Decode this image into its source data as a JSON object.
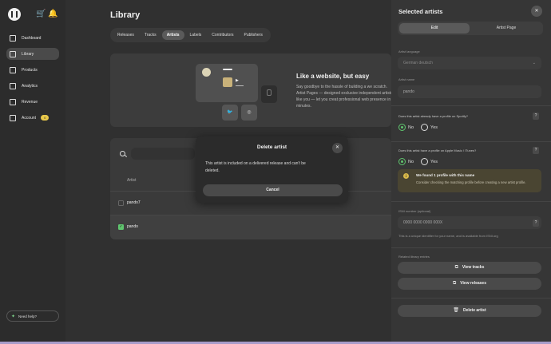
{
  "sidebar": {
    "items": [
      {
        "label": "Dashboard",
        "icon": "home-icon"
      },
      {
        "label": "Library",
        "icon": "library-icon",
        "active": true
      },
      {
        "label": "Products",
        "icon": "products-icon"
      },
      {
        "label": "Analytics",
        "icon": "analytics-icon"
      },
      {
        "label": "Revenue",
        "icon": "revenue-icon"
      },
      {
        "label": "Account",
        "icon": "account-icon",
        "badge": "0"
      }
    ],
    "help_label": "Need help?"
  },
  "main": {
    "title": "Library",
    "tabs": [
      "Releases",
      "Tracks",
      "Artists",
      "Labels",
      "Contributors",
      "Publishers"
    ],
    "active_tab": "Artists",
    "promo": {
      "title": "Like a website, but easy",
      "text": "Say goodbye to the hassle of building a we scratch. Artist Pages — designed exclusive independent artists like you — let you creat professional web presence in minutes."
    },
    "table": {
      "column_artist": "Artist",
      "rows": [
        {
          "name": "pando7",
          "checked": false
        },
        {
          "name": "pando",
          "checked": true
        }
      ]
    }
  },
  "dialog": {
    "title": "Delete artist",
    "message": "This artist is included on a delivered release and can't be deleted.",
    "cancel_label": "Cancel"
  },
  "panel": {
    "title": "Selected artists",
    "tabs": [
      "Edit",
      "Artist Page"
    ],
    "language_label": "Artist language",
    "language_value": "German deutsch",
    "name_label": "Artist name",
    "name_value": "pando",
    "spotify_question": "Does this artist already have a profile on Spotify?",
    "spotify_options": [
      "No",
      "Yes"
    ],
    "apple_question": "Does this artist have a profile on Apple Music / iTunes?",
    "apple_options": [
      "No",
      "Yes"
    ],
    "notice_title": "We found 1 profile with this name",
    "notice_text": "Consider checking the matching profile before creating a new artist profile.",
    "isni_label": "ISNI number (optional)",
    "isni_placeholder": "0000 0000 0000 000X",
    "isni_hint": "This is a unique identifier for your name, and is available from ISNI.org",
    "related_label": "Related library entries",
    "view_tracks": "View tracks",
    "view_releases": "View releases",
    "delete_label": "Delete artist",
    "help_mark": "?"
  },
  "colors": {
    "accent_green": "#5fc56e",
    "badge_yellow": "#e8c84a",
    "notice_bg": "#4a4532"
  }
}
